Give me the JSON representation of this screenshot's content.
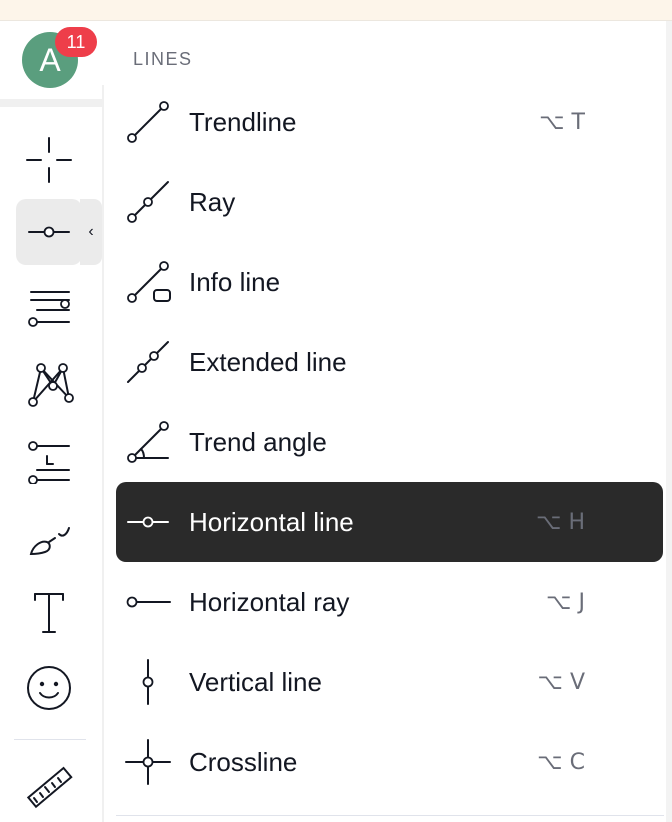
{
  "user": {
    "avatar_letter": "A",
    "notification_count": "11"
  },
  "toolbar": {
    "tools": [
      {
        "name": "crosshair-icon",
        "active": false
      },
      {
        "name": "horizontal-line-tool-icon",
        "active": true
      },
      {
        "name": "fib-retracement-icon",
        "active": false
      },
      {
        "name": "pattern-icon",
        "active": false
      },
      {
        "name": "prediction-icon",
        "active": false
      },
      {
        "name": "brush-icon",
        "active": false
      },
      {
        "name": "text-icon",
        "active": false
      },
      {
        "name": "emoji-icon",
        "active": false
      },
      {
        "name": "ruler-icon",
        "active": false
      }
    ],
    "collapse_glyph": "‹"
  },
  "menu": {
    "header": "LINES",
    "items": [
      {
        "label": "Trendline",
        "shortcut": "⌥ T",
        "icon": "trendline-icon"
      },
      {
        "label": "Ray",
        "shortcut": "",
        "icon": "ray-icon"
      },
      {
        "label": "Info line",
        "shortcut": "",
        "icon": "info-line-icon"
      },
      {
        "label": "Extended line",
        "shortcut": "",
        "icon": "extended-line-icon"
      },
      {
        "label": "Trend angle",
        "shortcut": "",
        "icon": "trend-angle-icon"
      },
      {
        "label": "Horizontal line",
        "shortcut": "⌥ H",
        "icon": "horizontal-line-icon",
        "active": true
      },
      {
        "label": "Horizontal ray",
        "shortcut": "⌥ J",
        "icon": "horizontal-ray-icon"
      },
      {
        "label": "Vertical line",
        "shortcut": "⌥ V",
        "icon": "vertical-line-icon"
      },
      {
        "label": "Crossline",
        "shortcut": "⌥ C",
        "icon": "crossline-icon"
      }
    ]
  },
  "colors": {
    "active_item_bg": "#2a2a2a",
    "avatar_bg": "#5a9e7e",
    "badge_bg": "#ee3e4a",
    "top_strip": "#fdf5ea"
  }
}
